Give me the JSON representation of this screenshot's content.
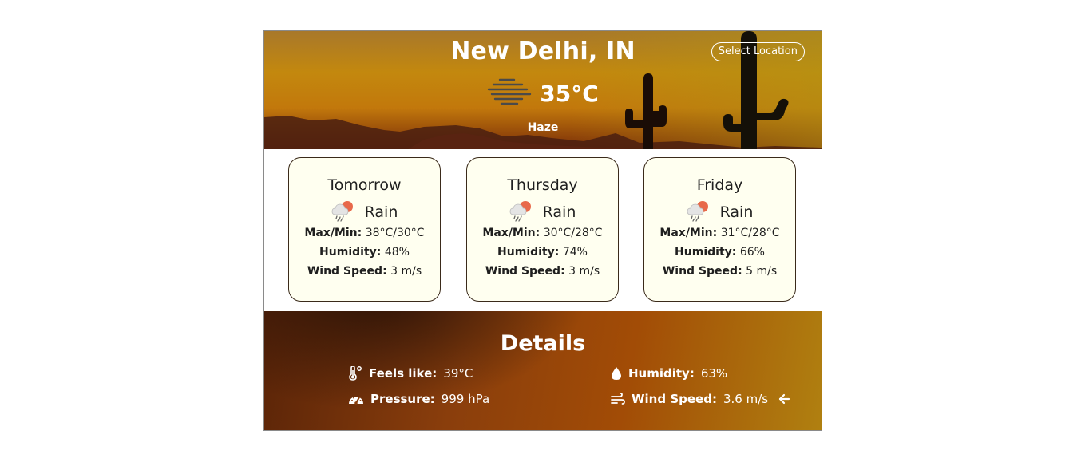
{
  "header": {
    "city": "New Delhi, IN",
    "select_location_label": "Select Location",
    "temperature": "35°C",
    "condition": "Haze",
    "condition_icon": "haze-icon"
  },
  "forecast": [
    {
      "day": "Tomorrow",
      "condition": "Rain",
      "icon": "rain-cloud-icon",
      "maxmin_label": "Max/Min:",
      "maxmin_value": "38°C/30°C",
      "humidity_label": "Humidity:",
      "humidity_value": "48%",
      "wind_label": "Wind Speed:",
      "wind_value": "3 m/s"
    },
    {
      "day": "Thursday",
      "condition": "Rain",
      "icon": "rain-cloud-icon",
      "maxmin_label": "Max/Min:",
      "maxmin_value": "30°C/28°C",
      "humidity_label": "Humidity:",
      "humidity_value": "74%",
      "wind_label": "Wind Speed:",
      "wind_value": "3 m/s"
    },
    {
      "day": "Friday",
      "condition": "Rain",
      "icon": "rain-cloud-icon",
      "maxmin_label": "Max/Min:",
      "maxmin_value": "31°C/28°C",
      "humidity_label": "Humidity:",
      "humidity_value": "66%",
      "wind_label": "Wind Speed:",
      "wind_value": "5 m/s"
    }
  ],
  "details": {
    "title": "Details",
    "feels_like_label": "Feels like:",
    "feels_like_value": "39°C",
    "humidity_label": "Humidity:",
    "humidity_value": "63%",
    "pressure_label": "Pressure:",
    "pressure_value": "999 hPa",
    "wind_label": "Wind Speed:",
    "wind_value": "3.6 m/s",
    "wind_direction_icon": "arrow-left-icon"
  },
  "colors": {
    "card_background": "#fffff0",
    "card_border": "#3a2a1a",
    "header_sky": "#c3880e",
    "details_gradient_end": "#b08010"
  }
}
